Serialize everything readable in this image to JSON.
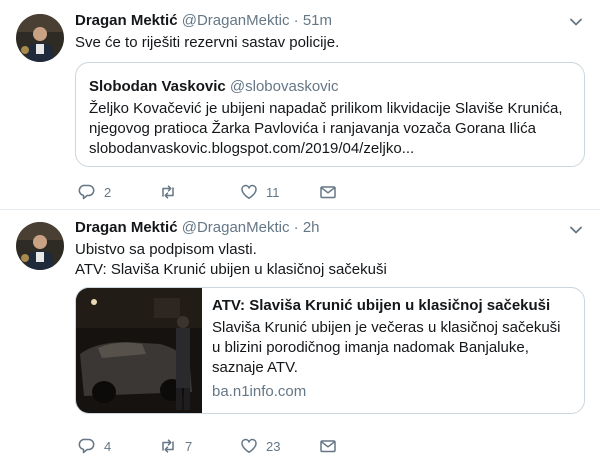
{
  "tweets": [
    {
      "name": "Dragan Mektić",
      "handle": "@DraganMektic",
      "dot": "·",
      "time": "51m",
      "text": "Sve će to riješiti rezervni sastav policije.",
      "quote": {
        "name": "Slobodan Vaskovic",
        "handle": "@slobovaskovic",
        "text": "Željko Kovačević je ubijeni napadač prilikom likvidacije Slaviše Krunića, njegovog pratioca Žarka Pavlovića i ranjavanja vozača Gorana Ilića slobodanvaskovic.blogspot.com/2019/04/zeljko..."
      },
      "replies": "2",
      "retweets": "",
      "likes": "11"
    },
    {
      "name": "Dragan Mektić",
      "handle": "@DraganMektic",
      "dot": "·",
      "time": "2h",
      "text_line1": "Ubistvo sa podpisom vlasti.",
      "text_line2": "ATV: Slaviša Krunić ubijen u klasičnoj sačekuši",
      "card": {
        "title": "ATV: Slaviša Krunić ubijen u klasičnoj sačekuši",
        "description": "Slaviša Krunić ubijen je večeras u klasičnoj sačekuši u blizini porodičnog imanja nadomak Banjaluke, saznaje ATV.",
        "domain": "ba.n1info.com"
      },
      "replies": "4",
      "retweets": "7",
      "likes": "23"
    }
  ],
  "icons": {
    "caret": "chevron-down-icon",
    "reply": "reply-icon",
    "retweet": "retweet-icon",
    "like": "heart-icon",
    "message": "envelope-icon"
  },
  "colors": {
    "text": "#14171a",
    "secondary": "#657786",
    "border": "#ccd6dd",
    "divider": "#e6ecf0"
  }
}
